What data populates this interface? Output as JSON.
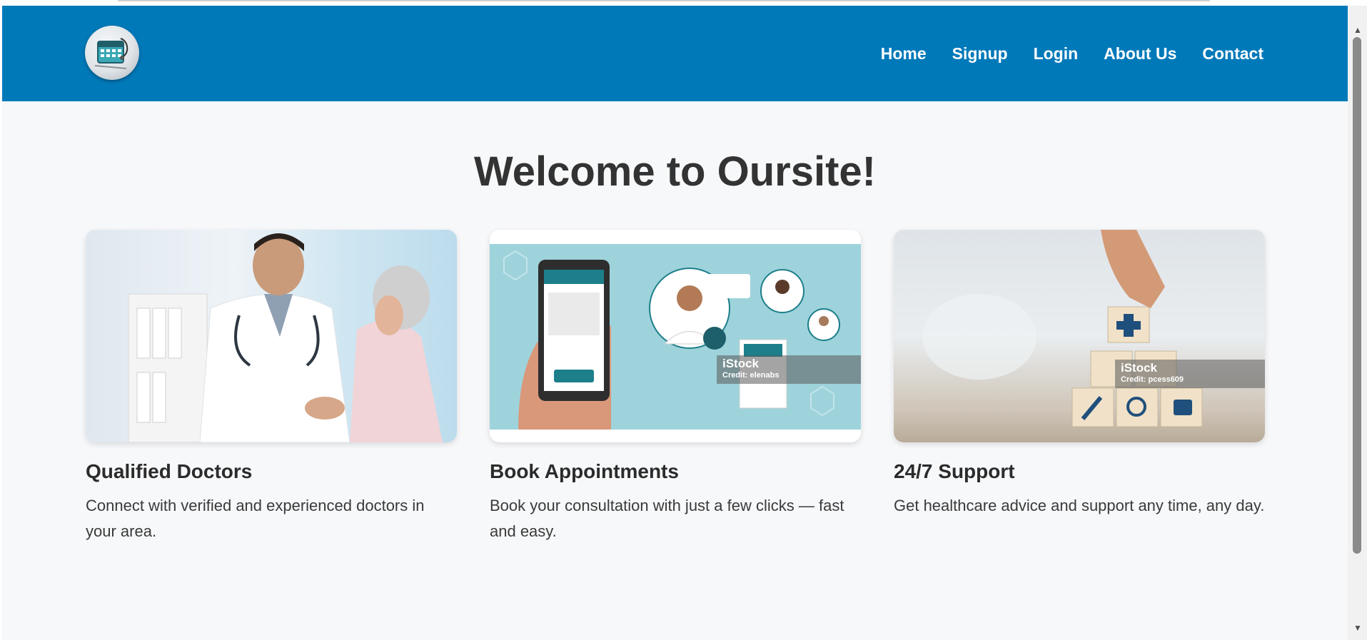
{
  "nav": {
    "items": [
      "Home",
      "Signup",
      "Login",
      "About Us",
      "Contact"
    ]
  },
  "headline": "Welcome to Oursite!",
  "cards": [
    {
      "title": "Qualified Doctors",
      "text": "Connect with verified and experienced doctors in your area."
    },
    {
      "title": "Book Appointments",
      "text": "Book your consultation with just a few clicks — fast and easy.",
      "watermark_brand": "iStock",
      "watermark_credit": "Credit: elenabs"
    },
    {
      "title": "24/7 Support",
      "text": "Get healthcare advice and support any time, any day.",
      "watermark_brand": "iStock",
      "watermark_credit": "Credit: pcess609"
    }
  ],
  "colors": {
    "navbar": "#0079b9",
    "page_bg": "#f7f8fa",
    "teal_illustration": "#9ed3dc"
  },
  "icons": [
    "logo-calendar-stethoscope-icon",
    "scroll-up-arrow-icon",
    "scroll-down-arrow-icon"
  ]
}
